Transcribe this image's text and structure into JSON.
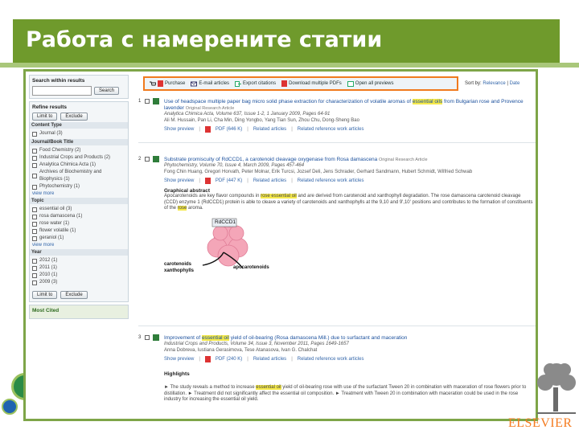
{
  "slide": {
    "title": "Работа с намерените статии",
    "publisher": "ELSEVIER"
  },
  "colors": {
    "accent": "#6f9a2c",
    "highlight_box": "#f07a1e",
    "link": "#3366aa"
  },
  "sidebar": {
    "search": {
      "label": "Search within results",
      "button": "Search"
    },
    "refine": {
      "label": "Refine results",
      "limit": "Limit to",
      "exclude": "Exclude"
    },
    "content_type": {
      "label": "Content Type",
      "items": [
        {
          "label": "Journal (3)"
        }
      ]
    },
    "journal_title": {
      "label": "Journal/Book Title",
      "items": [
        {
          "label": "Food Chemistry (2)"
        },
        {
          "label": "Industrial Crops and Products (2)"
        },
        {
          "label": "Analytica Chimica Acta (1)"
        },
        {
          "label": "Archives of Biochemistry and Biophysics (1)"
        },
        {
          "label": "Phytochemistry (1)"
        }
      ],
      "more": "view more"
    },
    "topic": {
      "label": "Topic",
      "items": [
        {
          "label": "essential oil (3)"
        },
        {
          "label": "rosa damascena (1)"
        },
        {
          "label": "rose water (1)"
        },
        {
          "label": "flower volatile (1)"
        },
        {
          "label": "geraniol (1)"
        }
      ],
      "more": "view more"
    },
    "year": {
      "label": "Year",
      "items": [
        {
          "label": "2012 (1)"
        },
        {
          "label": "2011 (1)"
        },
        {
          "label": "2010 (1)"
        },
        {
          "label": "2009 (3)"
        }
      ]
    },
    "bottom_buttons": {
      "limit": "Limit to",
      "exclude": "Exclude"
    },
    "most_cited": "Most Cited"
  },
  "toolbar": {
    "purchase": "Purchase",
    "email": "E-mail articles",
    "export": "Export citations",
    "download": "Download multiple PDFs",
    "open": "Open all previews"
  },
  "sort": {
    "label": "Sort by:",
    "relevance": "Relevance",
    "date": "Date"
  },
  "results": [
    {
      "num": "1",
      "title_pre": "Use of headspace multiple paper bag micro solid phase extraction for characterization of volatile aromas of ",
      "title_hl": "essential oils",
      "title_post": " from Bulgarian rose and Provence lavender",
      "type": "Original Research Article",
      "journal": "Analytica Chimica Acta, Volume 637, Issue 1-2, 1 January 2009, Pages 64-91",
      "authors": "Ali M. Hussain, Pan Li, Cha Min, Ding Yongbo, Yang Tian Sun, Zhou Chu, Dong-Sheng Bao",
      "preview": "Show preview",
      "pdf": "PDF (646 K)",
      "related": "Related articles",
      "related_ref": "Related reference work articles"
    },
    {
      "num": "2",
      "title": "Substrate promiscuity of RdCCD1, a carotenoid cleavage oxygenase from Rosa damascena",
      "type": "Original Research Article",
      "journal": "Phytochemistry, Volume 70, Issue 4, March 2009, Pages 457-464",
      "authors": "Fong Chin Huang, Gregori Horvath, Peter Molnar, Erik Turcsi, Jozsef Deli, Jens Schrader, Gerhard Sandmann, Hubert Schmidt, Wilfried Schwab",
      "preview": "Show preview",
      "pdf": "PDF (447 K)",
      "related": "Related articles",
      "related_ref": "Related reference work articles",
      "graphical_abstract": {
        "label": "Graphical abstract",
        "text_1": "Apocarotenoids are key flavor compounds in ",
        "hl_1": "rose essential oil",
        "text_2": " and are derived from carotenoid and xanthophyll degradation. The rose damascena carotenoid cleavage (CCD) enzyme 1 (RdCCD1) protein is able to cleave a variety of carotenoids and xanthophylls at the 9,10 and 9',10' positions and contributes to the formation of constituents of the ",
        "hl_2": "rose",
        "text_3": " aroma.",
        "enzyme_label": "RdCCD1",
        "left_label_1": "carotenoids",
        "left_label_2": "xanthophylls",
        "right_label": "apocarotenoids"
      }
    },
    {
      "num": "3",
      "title_pre": "Improvement of ",
      "title_hl": "essential oil",
      "title_post": " yield of oil-bearing (Rosa damascena Mill.) due to surfactant and maceration",
      "journal": "Industrial Crops and Products, Volume 34, Issue 3, November 2011, Pages 1649-1657",
      "authors": "Anna Dobreva, Iustiana Gerasimova, Tese Atanasova, Ivan G. Chalchat",
      "preview": "Show preview",
      "pdf": "PDF (240 K)",
      "related": "Related articles",
      "related_ref": "Related reference work articles",
      "highlights_label": "Highlights",
      "highlights_text_1": "► The study reveals a method to increase ",
      "highlights_hl": "essential oil",
      "highlights_text_2": " yield of oil-bearing rose with use of the surfactant Tween 20 in combination with maceration of rose flowers prior to distillation. ► Treatment did not significantly affect the essential oil composition. ► Treatment with Tween 20 in combination with maceration could be used in the rose industry for increasing the essential oil yield."
    }
  ]
}
